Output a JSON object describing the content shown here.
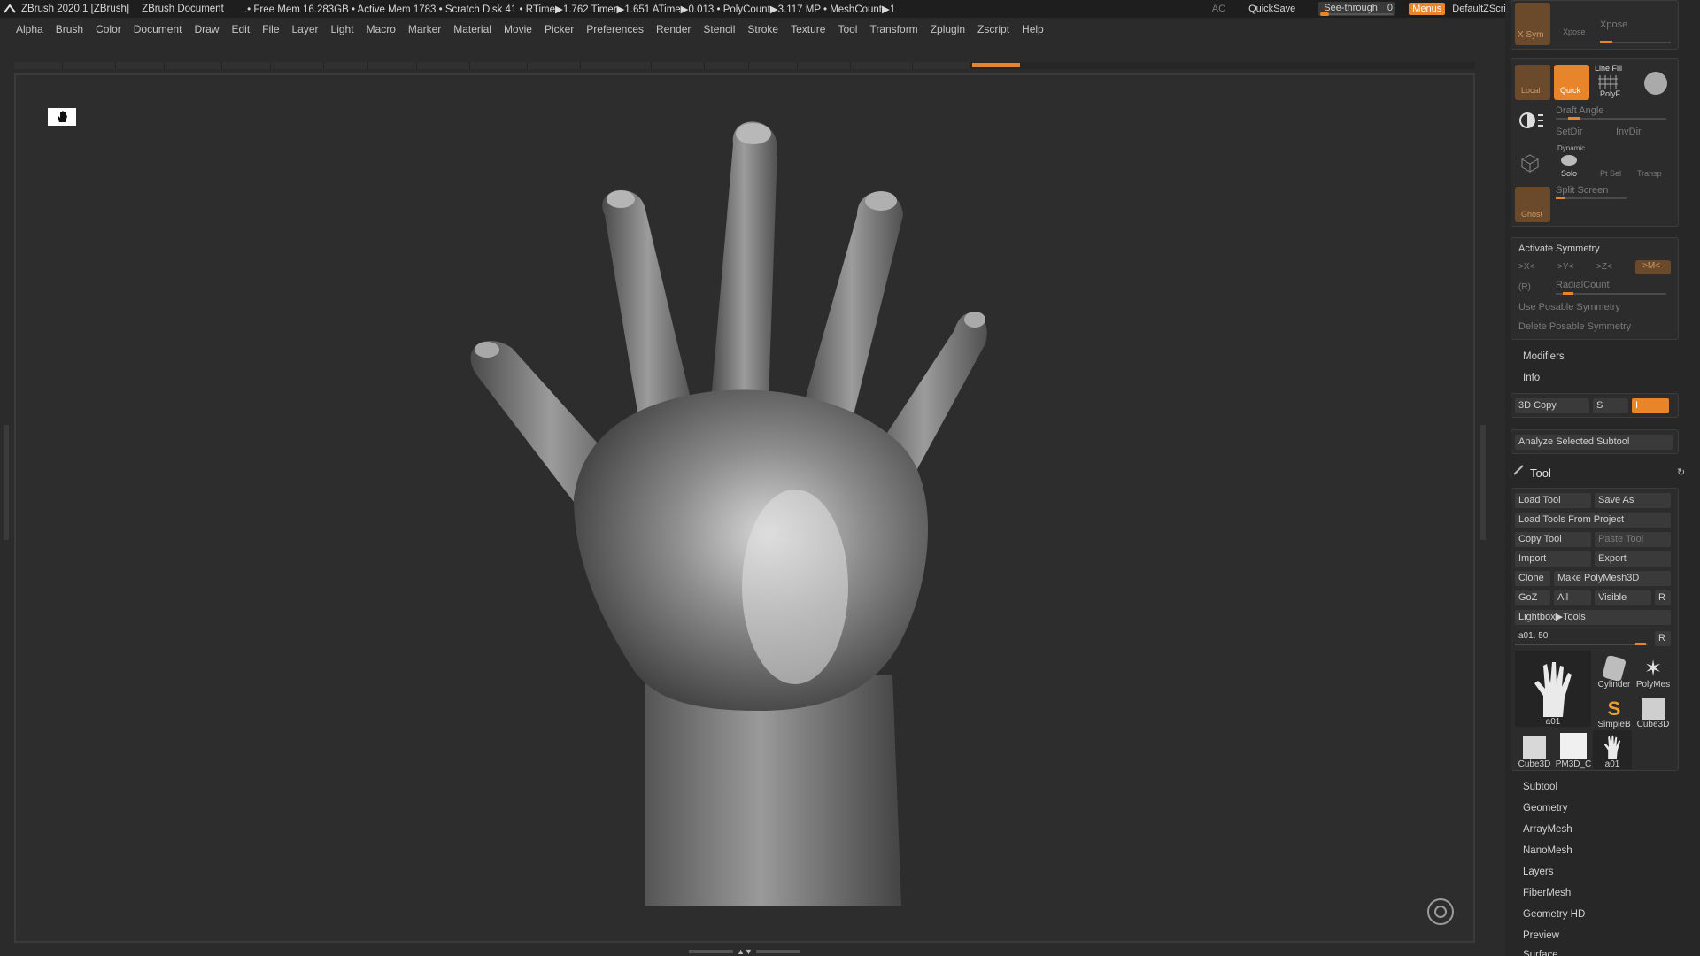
{
  "titlebar": {
    "app": "ZBrush 2020.1 [ZBrush]",
    "document": "ZBrush Document",
    "stats": "..• Free Mem 16.283GB • Active Mem 1783 • Scratch Disk 41 • RTime▶1.762 Timer▶1.651 ATime▶0.013 • PolyCount▶3.117 MP • MeshCount▶1",
    "ac": "AC",
    "quicksave": "QuickSave",
    "see_through_label": "See-through",
    "see_through_value": "0",
    "menus": "Menus",
    "default_zscript": "DefaultZScript"
  },
  "menubar": [
    "Alpha",
    "Brush",
    "Color",
    "Document",
    "Draw",
    "Edit",
    "File",
    "Layer",
    "Light",
    "Macro",
    "Marker",
    "Material",
    "Movie",
    "Picker",
    "Preferences",
    "Render",
    "Stencil",
    "Stroke",
    "Texture",
    "Tool",
    "Transform",
    "Zplugin",
    "Zscript",
    "Help"
  ],
  "right_top": {
    "xsym": "X Sym",
    "xpose": "Xpose",
    "xpose2": "Xpose",
    "local": "Local",
    "quick": "Quick",
    "line_fill": "Line Fill",
    "polyf": "PolyF",
    "draft_angle": "Draft Angle",
    "setdir": "SetDir",
    "invdir": "InvDir",
    "dynamic": "Dynamic",
    "solo": "Solo",
    "pt_sel": "Pt Sel",
    "transp": "Transp",
    "ghost": "Ghost",
    "split_screen": "Split Screen"
  },
  "symmetry": {
    "title": "Activate Symmetry",
    "x": ">X<",
    "y": ">Y<",
    "z": ">Z<",
    "m": ">M<",
    "r": "(R)",
    "radial": "RadialCount",
    "use_posable": "Use Posable Symmetry",
    "delete_posable": "Delete Posable Symmetry"
  },
  "modifiers": "Modifiers",
  "info": "Info",
  "copy3d": {
    "label": "3D Copy",
    "s": "S",
    "i": "I"
  },
  "analyze": "Analyze Selected Subtool",
  "tool": {
    "title": "Tool",
    "load_tool": "Load Tool",
    "save_as": "Save As",
    "load_from_project": "Load Tools From Project",
    "copy_tool": "Copy Tool",
    "paste_tool": "Paste Tool",
    "import": "Import",
    "export": "Export",
    "clone": "Clone",
    "make_polymesh": "Make PolyMesh3D",
    "goz": "GoZ",
    "all": "All",
    "visible": "Visible",
    "r": "R",
    "lightbox_tools": "Lightbox▶Tools",
    "current": "a01. 50",
    "r2": "R",
    "thumbs": {
      "main": "a01",
      "cylinder": "Cylinder",
      "polymesh": "PolyMes",
      "simpleb": "SimpleB",
      "cube3d_a": "Cube3D",
      "cube3d_b": "Cube3D",
      "pm3d": "PM3D_C",
      "a01b": "a01"
    }
  },
  "sections": [
    "Subtool",
    "Geometry",
    "ArrayMesh",
    "NanoMesh",
    "Layers",
    "FiberMesh",
    "Geometry HD",
    "Preview",
    "Surface"
  ]
}
